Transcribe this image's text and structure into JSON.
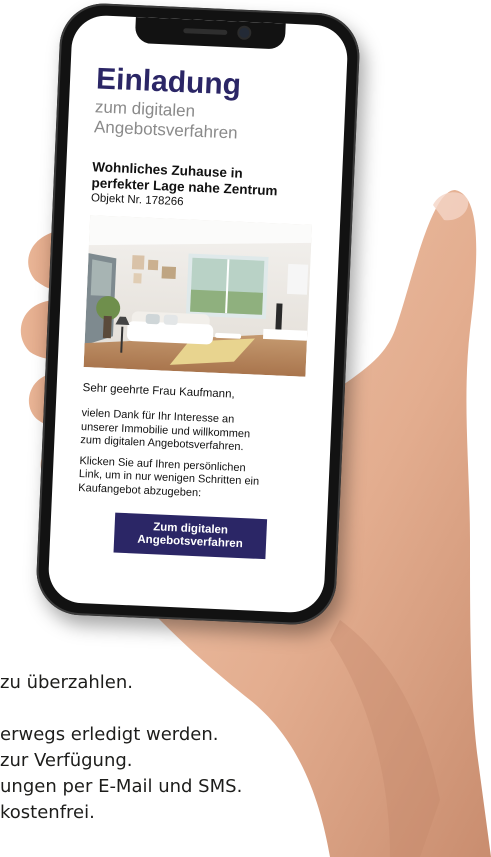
{
  "background_lines": [
    "zu überzahlen.",
    "erwegs erledigt werden.",
    "zur Verfügung.",
    "ungen per E-Mail und SMS.",
    "kostenfrei."
  ],
  "email": {
    "title": "Einladung",
    "subtitle_line1": "zum digitalen",
    "subtitle_line2": "Angebotsverfahren",
    "headline_line1": "Wohnliches Zuhause in",
    "headline_line2": "perfekter Lage nahe Zentrum",
    "object_number": "Objekt Nr. 178266",
    "greeting": "Sehr geehrte Frau Kaufmann,",
    "paragraph1_line1": "vielen Dank für Ihr Interesse an",
    "paragraph1_line2": "unserer Immobilie und willkommen",
    "paragraph1_line3": "zum digitalen Angebotsverfahren.",
    "paragraph2_line1": "Klicken Sie auf Ihren persönlichen",
    "paragraph2_line2": "Link, um in nur wenigen Schritten ein",
    "paragraph2_line3": "Kaufangebot abzugeben:",
    "cta_line1": "Zum digitalen",
    "cta_line2": "Angebotsverfahren"
  },
  "colors": {
    "brand": "#2b2666",
    "phone_frame": "#121212",
    "skin": "#e8b79b"
  }
}
